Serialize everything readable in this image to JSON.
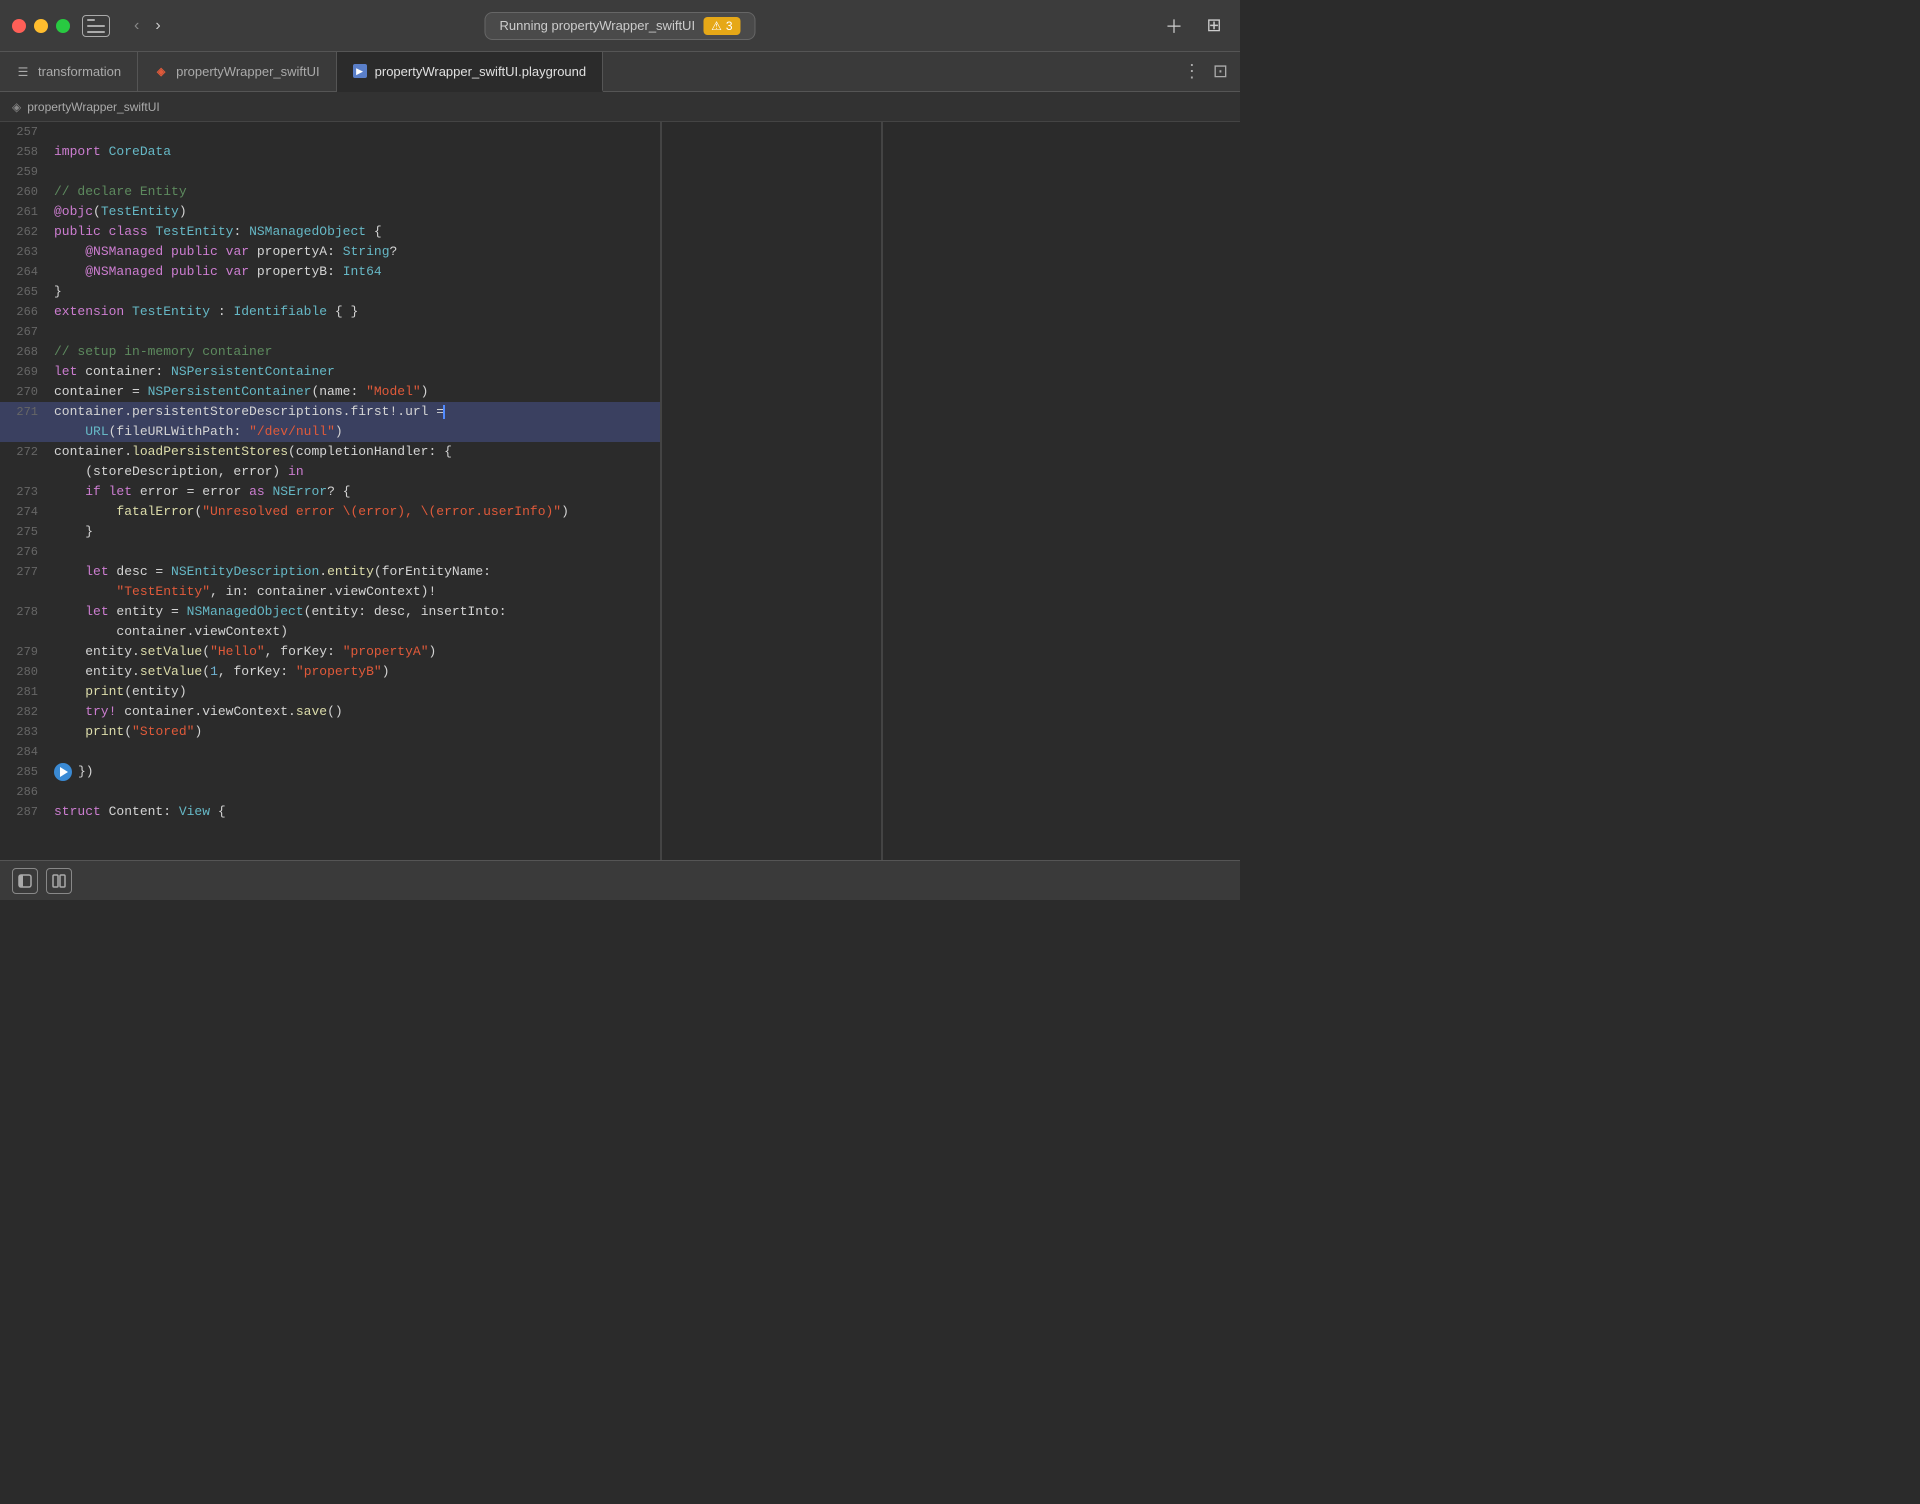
{
  "titlebar": {
    "running_label": "Running propertyWrapper_swiftUI",
    "warning_count": "3",
    "sidebar_toggle_label": "Toggle Sidebar"
  },
  "tabs": [
    {
      "id": "transformation",
      "label": "transformation",
      "icon_type": "file",
      "active": false
    },
    {
      "id": "propertyWrapper_swiftUI",
      "label": "propertyWrapper_swiftUI",
      "icon_type": "swift",
      "active": false
    },
    {
      "id": "propertyWrapper_swiftUI_playground",
      "label": "propertyWrapper_swiftUI.playground",
      "icon_type": "playground",
      "active": true
    }
  ],
  "filepath": {
    "label": "propertyWrapper_swiftUI"
  },
  "code": {
    "lines": [
      {
        "num": "257",
        "content": "",
        "highlighted": false
      },
      {
        "num": "258",
        "content": "import CoreData",
        "highlighted": false
      },
      {
        "num": "259",
        "content": "",
        "highlighted": false
      },
      {
        "num": "260",
        "content": "// declare Entity",
        "highlighted": false,
        "comment": true
      },
      {
        "num": "261",
        "content": "@objc(TestEntity)",
        "highlighted": false
      },
      {
        "num": "262",
        "content": "public class TestEntity: NSManagedObject {",
        "highlighted": false
      },
      {
        "num": "263",
        "content": "    @NSManaged public var propertyA: String?",
        "highlighted": false
      },
      {
        "num": "264",
        "content": "    @NSManaged public var propertyB: Int64",
        "highlighted": false
      },
      {
        "num": "265",
        "content": "}",
        "highlighted": false
      },
      {
        "num": "266",
        "content": "extension TestEntity : Identifiable { }",
        "highlighted": false
      },
      {
        "num": "267",
        "content": "",
        "highlighted": false
      },
      {
        "num": "268",
        "content": "// setup in-memory container",
        "highlighted": false,
        "comment": true
      },
      {
        "num": "269",
        "content": "let container: NSPersistentContainer",
        "highlighted": false
      },
      {
        "num": "270",
        "content": "container = NSPersistentContainer(name: \"Model\")",
        "highlighted": false
      },
      {
        "num": "271",
        "content": "container.persistentStoreDescriptions.first!.url =",
        "highlighted": true
      },
      {
        "num": "271b",
        "content": "    URL(fileURLWithPath: \"/dev/null\")",
        "highlighted": true
      },
      {
        "num": "272",
        "content": "container.loadPersistentStores(completionHandler: {",
        "highlighted": false
      },
      {
        "num": "272b",
        "content": "    (storeDescription, error) in",
        "highlighted": false
      },
      {
        "num": "273",
        "content": "    if let error = error as NSError? {",
        "highlighted": false
      },
      {
        "num": "274",
        "content": "        fatalError(\"Unresolved error \\(error), \\(error.userInfo)\")",
        "highlighted": false
      },
      {
        "num": "275",
        "content": "    }",
        "highlighted": false
      },
      {
        "num": "276",
        "content": "",
        "highlighted": false
      },
      {
        "num": "277",
        "content": "    let desc = NSEntityDescription.entity(forEntityName:",
        "highlighted": false
      },
      {
        "num": "277b",
        "content": "        \"TestEntity\", in: container.viewContext)!",
        "highlighted": false
      },
      {
        "num": "278",
        "content": "    let entity = NSManagedObject(entity: desc, insertInto:",
        "highlighted": false
      },
      {
        "num": "278b",
        "content": "        container.viewContext)",
        "highlighted": false
      },
      {
        "num": "279",
        "content": "    entity.setValue(\"Hello\", forKey: \"propertyA\")",
        "highlighted": false
      },
      {
        "num": "280",
        "content": "    entity.setValue(1, forKey: \"propertyB\")",
        "highlighted": false
      },
      {
        "num": "281",
        "content": "    print(entity)",
        "highlighted": false
      },
      {
        "num": "282",
        "content": "    try! container.viewContext.save()",
        "highlighted": false
      },
      {
        "num": "283",
        "content": "    print(\"Stored\")",
        "highlighted": false
      },
      {
        "num": "284",
        "content": "",
        "highlighted": false
      },
      {
        "num": "285",
        "content": "})",
        "highlighted": false,
        "has_play": true
      },
      {
        "num": "286",
        "content": "",
        "highlighted": false
      },
      {
        "num": "287",
        "content": "struct Content: View {",
        "highlighted": false
      }
    ]
  },
  "bottom_bar": {
    "hide_label": "Hide",
    "split_label": "Split"
  }
}
